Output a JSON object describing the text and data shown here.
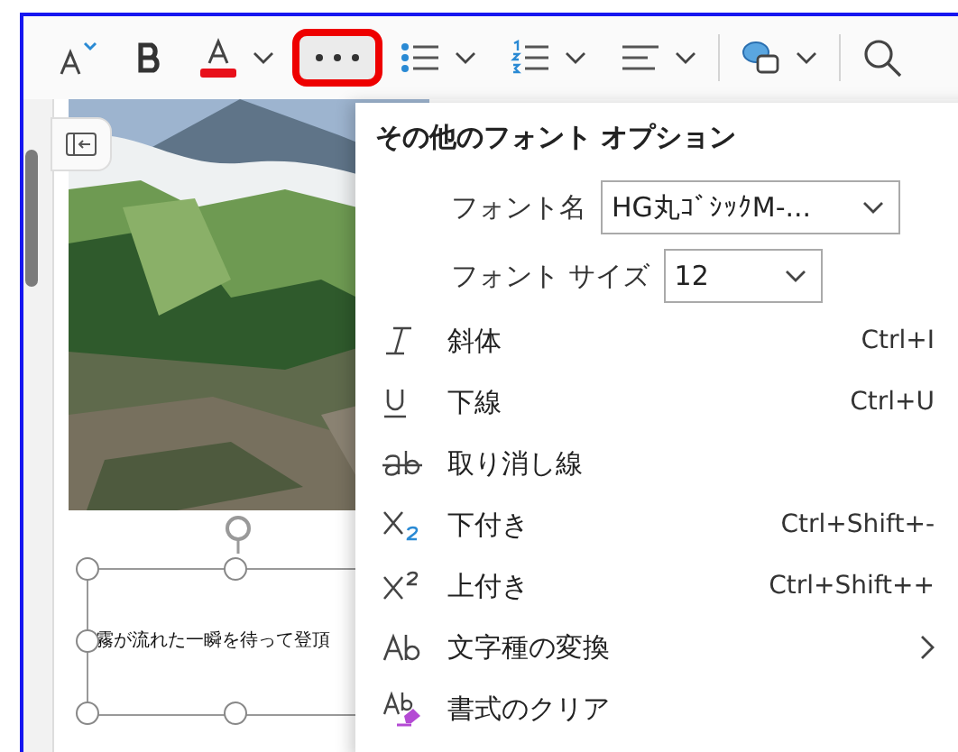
{
  "toolbar": {
    "buttons": [
      {
        "kind": "font-size",
        "dropdown": false,
        "pressed": false,
        "highlighted": false
      },
      {
        "kind": "bold",
        "dropdown": false,
        "pressed": false,
        "highlighted": false
      },
      {
        "kind": "font-color",
        "dropdown": true,
        "pressed": false,
        "highlighted": false
      },
      {
        "kind": "more",
        "dropdown": false,
        "pressed": true,
        "highlighted": true
      },
      {
        "kind": "bullets",
        "dropdown": true,
        "pressed": false,
        "highlighted": false
      },
      {
        "kind": "numbering",
        "dropdown": true,
        "pressed": false,
        "highlighted": false
      },
      {
        "kind": "align",
        "dropdown": true,
        "pressed": false,
        "highlighted": false
      },
      {
        "kind": "separator"
      },
      {
        "kind": "shapes",
        "dropdown": true,
        "pressed": false,
        "highlighted": false
      },
      {
        "kind": "separator"
      },
      {
        "kind": "search",
        "dropdown": false,
        "pressed": false,
        "highlighted": false
      }
    ]
  },
  "slide": {
    "text_box": {
      "text": "霧が流れた一瞬を待って登頂",
      "selected": true
    }
  },
  "font_menu": {
    "title": "その他のフォント オプション",
    "fields": [
      {
        "label": "フォント名",
        "value": "HG丸ｺﾞｼｯｸM-..."
      },
      {
        "label": "フォント サイズ",
        "value": "12"
      }
    ],
    "items": [
      {
        "label": "斜体",
        "shortcut": "Ctrl+I",
        "submenu": false
      },
      {
        "label": "下線",
        "shortcut": "Ctrl+U",
        "submenu": false
      },
      {
        "label": "取り消し線",
        "submenu": false
      },
      {
        "label": "下付き",
        "shortcut": "Ctrl+Shift+-",
        "submenu": false
      },
      {
        "label": "上付き",
        "shortcut": "Ctrl+Shift++",
        "submenu": false
      },
      {
        "label": "文字種の変換",
        "submenu": true
      },
      {
        "label": "書式のクリア",
        "submenu": false
      }
    ]
  }
}
